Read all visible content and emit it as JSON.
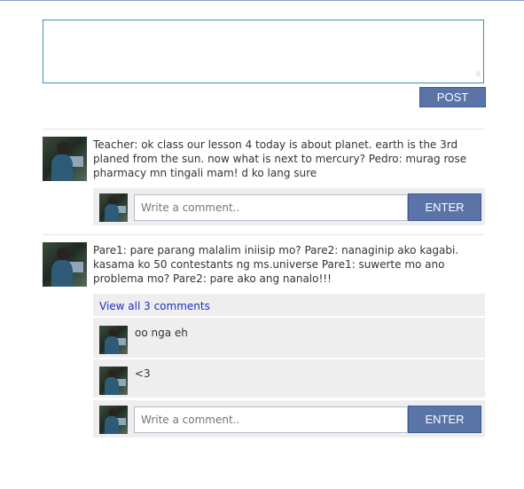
{
  "composer": {
    "value": "",
    "post_label": "POST"
  },
  "posts": [
    {
      "text": "Teacher: ok class our lesson 4 today is about planet. earth is the 3rd planed from the sun. now what is next to mercury? Pedro: murag rose pharmacy mn tingali mam! d ko lang sure",
      "comment_box": {
        "placeholder": "Write a comment..",
        "enter_label": "ENTER"
      }
    },
    {
      "text": "Pare1: pare parang malalim iniisip mo? Pare2: nanaginip ako kagabi. kasama ko 50 contestants ng ms.universe Pare1: suwerte mo ano problema mo? Pare2: pare ako ang nanalo!!!",
      "view_all_label": "View all 3 comments",
      "comments": [
        {
          "text": "oo nga eh"
        },
        {
          "text": "<3"
        }
      ],
      "comment_box": {
        "placeholder": "Write a comment..",
        "enter_label": "ENTER"
      }
    }
  ],
  "colors": {
    "button": "#5b74a8",
    "link": "#1c2fc2",
    "comment_bg": "#eeeeee",
    "composer_border": "#3a8fb7"
  }
}
